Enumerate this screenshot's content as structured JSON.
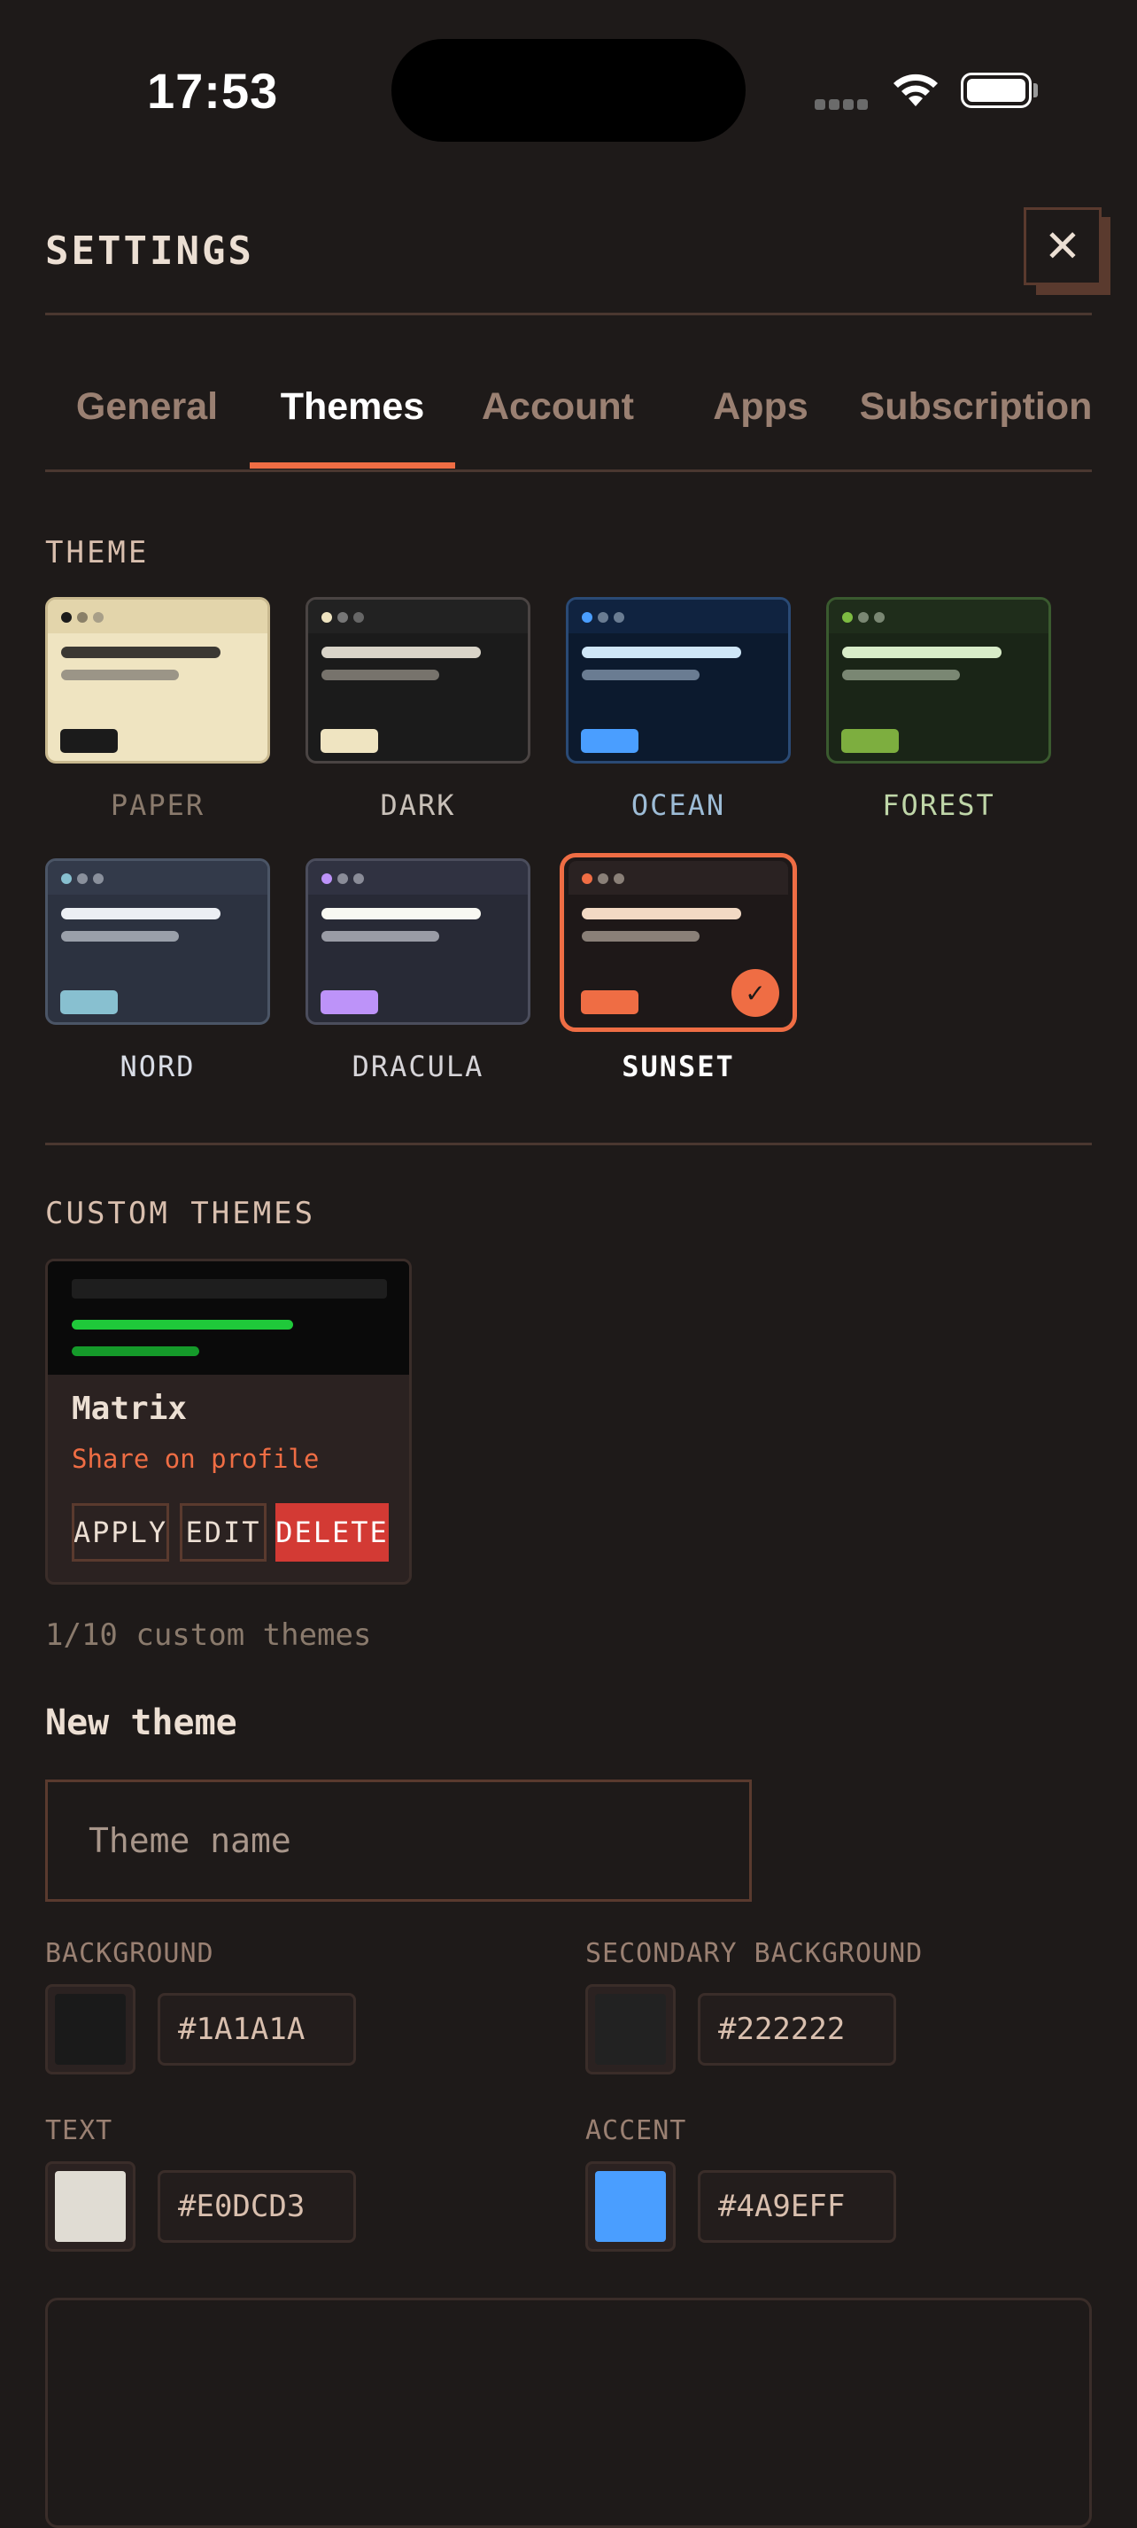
{
  "status_bar": {
    "time": "17:53"
  },
  "header": {
    "title": "SETTINGS",
    "close_glyph": "✕"
  },
  "tabs": [
    {
      "label": "General",
      "active": false
    },
    {
      "label": "Themes",
      "active": true
    },
    {
      "label": "Account",
      "active": false
    },
    {
      "label": "Apps",
      "active": false
    },
    {
      "label": "Subscription",
      "active": false
    }
  ],
  "theme_section": {
    "label": "THEME",
    "themes": [
      {
        "name": "PAPER",
        "selected": false
      },
      {
        "name": "DARK",
        "selected": false
      },
      {
        "name": "OCEAN",
        "selected": false
      },
      {
        "name": "FOREST",
        "selected": false
      },
      {
        "name": "NORD",
        "selected": false
      },
      {
        "name": "DRACULA",
        "selected": false
      },
      {
        "name": "SUNSET",
        "selected": true
      }
    ],
    "check_glyph": "✓"
  },
  "custom_section": {
    "label": "CUSTOM THEMES",
    "card": {
      "name": "Matrix",
      "share_link": "Share on profile",
      "apply_label": "APPLY",
      "edit_label": "EDIT",
      "delete_label": "DELETE"
    },
    "count_text": "1/10 custom themes"
  },
  "new_theme": {
    "heading": "New theme",
    "name_placeholder": "Theme name",
    "background": {
      "label": "BACKGROUND",
      "value": "#1A1A1A"
    },
    "secondary_background": {
      "label": "SECONDARY BACKGROUND",
      "value": "#222222"
    },
    "text": {
      "label": "TEXT",
      "value": "#E0DCD3"
    },
    "accent": {
      "label": "ACCENT",
      "value": "#4A9EFF"
    }
  },
  "colors": {
    "accent": "#EF6D44",
    "delete": "#D33A34",
    "background": "#1E1A19"
  }
}
